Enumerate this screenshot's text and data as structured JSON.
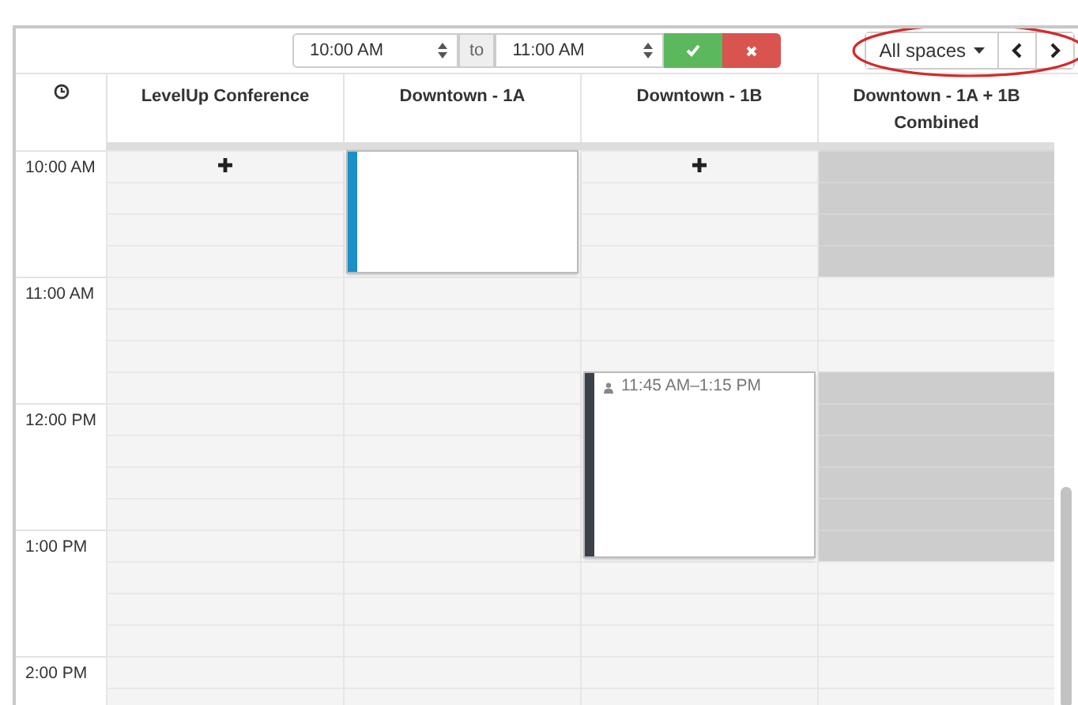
{
  "toolbar": {
    "start_time": "10:00 AM",
    "separator": "to",
    "end_time": "11:00 AM"
  },
  "space_filter": {
    "label": "All spaces"
  },
  "columns": [
    {
      "name": "LevelUp Conference"
    },
    {
      "name": "Downtown - 1A",
      "bookings": [
        {
          "color": "#1a8fc9"
        }
      ]
    },
    {
      "name": "Downtown - 1B",
      "bookings": [
        {
          "color": "#3a4148",
          "label": "11:45 AM–1:15 PM"
        }
      ]
    },
    {
      "name": "Downtown - 1A + 1B Combined"
    }
  ],
  "rows": [
    {
      "time": "10:00 AM",
      "cells": [
        {
          "kind": "add"
        },
        {
          "kind": "start"
        },
        {
          "kind": "add"
        },
        {
          "kind": "blocked"
        }
      ]
    },
    {
      "cells": [
        {
          "kind": "free"
        },
        {
          "kind": "cont"
        },
        {
          "kind": "free"
        },
        {
          "kind": "blocked"
        }
      ]
    },
    {
      "cells": [
        {
          "kind": "free"
        },
        {
          "kind": "cont"
        },
        {
          "kind": "free"
        },
        {
          "kind": "blocked"
        }
      ]
    },
    {
      "cells": [
        {
          "kind": "free"
        },
        {
          "kind": "cont"
        },
        {
          "kind": "free"
        },
        {
          "kind": "blocked"
        }
      ]
    },
    {
      "time": "11:00 AM",
      "cells": [
        {
          "kind": "free"
        },
        {
          "kind": "free"
        },
        {
          "kind": "free"
        },
        {
          "kind": "free"
        }
      ]
    },
    {
      "cells": [
        {
          "kind": "free"
        },
        {
          "kind": "free"
        },
        {
          "kind": "free"
        },
        {
          "kind": "free"
        }
      ]
    },
    {
      "cells": [
        {
          "kind": "free"
        },
        {
          "kind": "free"
        },
        {
          "kind": "free"
        },
        {
          "kind": "free"
        }
      ]
    },
    {
      "cells": [
        {
          "kind": "free"
        },
        {
          "kind": "free"
        },
        {
          "kind": "start"
        },
        {
          "kind": "blocked"
        }
      ]
    },
    {
      "time": "12:00 PM",
      "cells": [
        {
          "kind": "free"
        },
        {
          "kind": "free"
        },
        {
          "kind": "cont"
        },
        {
          "kind": "blocked"
        }
      ]
    },
    {
      "cells": [
        {
          "kind": "free"
        },
        {
          "kind": "free"
        },
        {
          "kind": "cont"
        },
        {
          "kind": "blocked"
        }
      ]
    },
    {
      "cells": [
        {
          "kind": "free"
        },
        {
          "kind": "free"
        },
        {
          "kind": "cont"
        },
        {
          "kind": "blocked"
        }
      ]
    },
    {
      "cells": [
        {
          "kind": "free"
        },
        {
          "kind": "free"
        },
        {
          "kind": "cont"
        },
        {
          "kind": "blocked"
        }
      ]
    },
    {
      "time": "1:00 PM",
      "cells": [
        {
          "kind": "free"
        },
        {
          "kind": "free"
        },
        {
          "kind": "cont"
        },
        {
          "kind": "blocked"
        }
      ]
    },
    {
      "cells": [
        {
          "kind": "free"
        },
        {
          "kind": "free"
        },
        {
          "kind": "free"
        },
        {
          "kind": "free"
        }
      ]
    },
    {
      "cells": [
        {
          "kind": "free"
        },
        {
          "kind": "free"
        },
        {
          "kind": "free"
        },
        {
          "kind": "free"
        }
      ]
    },
    {
      "cells": [
        {
          "kind": "free"
        },
        {
          "kind": "free"
        },
        {
          "kind": "free"
        },
        {
          "kind": "free"
        }
      ]
    },
    {
      "time": "2:00 PM",
      "cells": [
        {
          "kind": "free"
        },
        {
          "kind": "free"
        },
        {
          "kind": "free"
        },
        {
          "kind": "free"
        }
      ]
    },
    {
      "cells": [
        {
          "kind": "free"
        },
        {
          "kind": "free"
        },
        {
          "kind": "free"
        },
        {
          "kind": "free"
        }
      ]
    }
  ]
}
